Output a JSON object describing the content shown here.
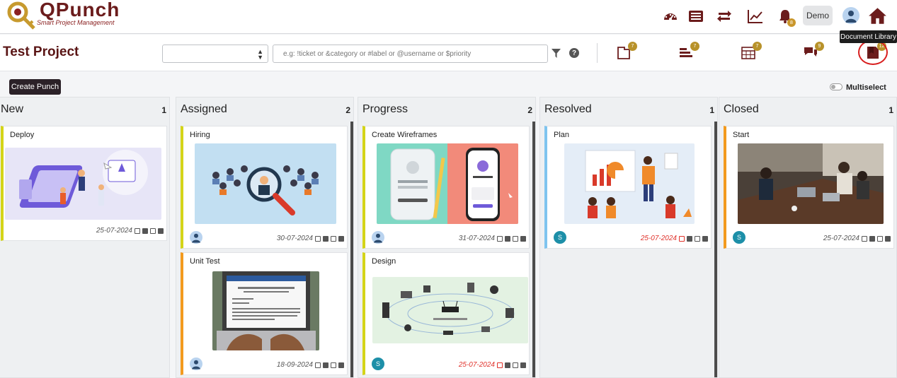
{
  "app": {
    "logo_title": "QPunch",
    "logo_subtitle": "Smart Project Management"
  },
  "header": {
    "icons": [
      "dashboard-icon",
      "list-icon",
      "sync-icon",
      "chart-icon",
      "bell-icon"
    ],
    "notification_badge": "8",
    "user_button": "Demo",
    "tooltip": "Document Library"
  },
  "project": {
    "title": "Test Project",
    "search_placeholder": "e.g: !ticket or &category or #label or @username or $priority",
    "toolbar_badges": [
      "7",
      "7",
      "7",
      "9",
      "12"
    ]
  },
  "actions": {
    "create_label": "Create Punch",
    "multiselect_label": "Multiselect"
  },
  "colors": {
    "brand": "#6b1c1c",
    "badge": "#b8922a",
    "yellow": "#d4d418",
    "orange": "#f39a1e",
    "blue": "#7fc4ef",
    "teal": "#1d8fa8",
    "overdue": "#e0322b"
  },
  "columns": [
    {
      "title": "New",
      "count": "1",
      "cards": [
        {
          "title": "Deploy",
          "date": "25-07-2024"
        }
      ]
    },
    {
      "title": "Assigned",
      "count": "2",
      "cards": [
        {
          "title": "Hiring",
          "date": "30-07-2024"
        },
        {
          "title": "Unit Test",
          "date": "18-09-2024"
        }
      ]
    },
    {
      "title": "Progress",
      "count": "2",
      "cards": [
        {
          "title": "Create Wireframes",
          "date": "31-07-2024"
        },
        {
          "title": "Design",
          "date": "25-07-2024"
        }
      ]
    },
    {
      "title": "Resolved",
      "count": "1",
      "cards": [
        {
          "title": "Plan",
          "date": "25-07-2024"
        }
      ]
    },
    {
      "title": "Closed",
      "count": "1",
      "cards": [
        {
          "title": "Start",
          "date": "25-07-2024"
        }
      ]
    }
  ],
  "avatars": {
    "initial": "S"
  }
}
